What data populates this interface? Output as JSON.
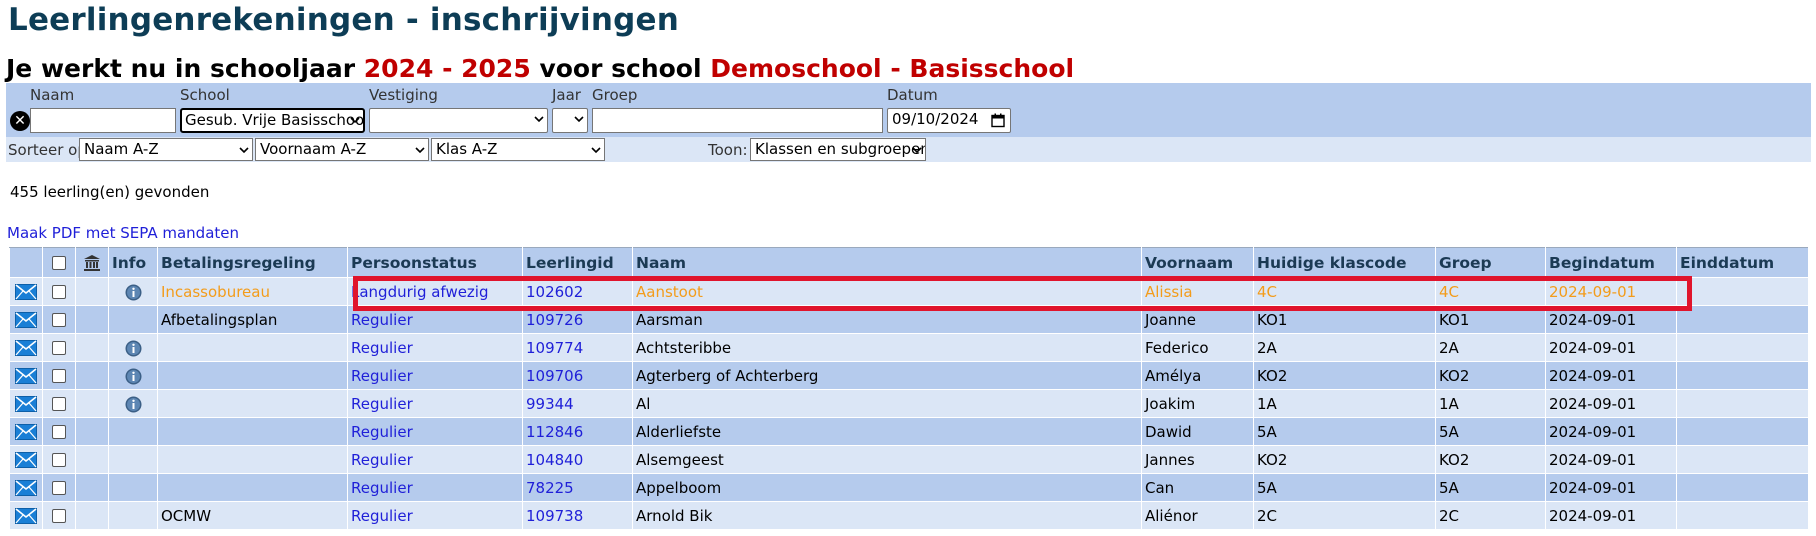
{
  "page": {
    "title": "Leerlingenrekeningen - inschrijvingen",
    "year_prefix": "Je werkt nu in schooljaar",
    "year": "2024 - 2025",
    "school_prefix": "voor school",
    "school": "Demoschool - Basisschool"
  },
  "filters": {
    "name_label": "Naam",
    "name_value": "",
    "school_label": "School",
    "school_value": "Gesub. Vrije Basisschool",
    "vestiging_label": "Vestiging",
    "vestiging_value": "",
    "jaar_label": "Jaar",
    "jaar_value": "",
    "groep_label": "Groep",
    "groep_value": "",
    "datum_label": "Datum",
    "datum_value": "09/10/2024",
    "clear_icon": "close-circle-icon"
  },
  "sort": {
    "label": "Sorteer op:",
    "sort1": "Naam A-Z",
    "sort2": "Voornaam A-Z",
    "sort3": "Klas A-Z",
    "show_label": "Toon:",
    "show_value": "Klassen en subgroepen"
  },
  "result_count": "455 leerling(en) gevonden",
  "pdf_link": "Maak PDF met SEPA mandaten",
  "table": {
    "headers": {
      "info": "Info",
      "betalingsregeling": "Betalingsregeling",
      "persoonstatus": "Persoonstatus",
      "leerlingid": "Leerlingid",
      "naam": "Naam",
      "voornaam": "Voornaam",
      "klascode": "Huidige klascode",
      "groep": "Groep",
      "begindatum": "Begindatum",
      "einddatum": "Einddatum"
    },
    "rows": [
      {
        "info": true,
        "betalingsregeling": "Incassobureau",
        "persoonstatus": "Langdurig afwezig",
        "leerlingid": "102602",
        "naam": "Aanstoot",
        "voornaam": "Alissia",
        "klascode": "4C",
        "groep": "4C",
        "begindatum": "2024-09-01",
        "einddatum": "",
        "highlight": true
      },
      {
        "info": false,
        "betalingsregeling": "Afbetalingsplan",
        "persoonstatus": "Regulier",
        "leerlingid": "109726",
        "naam": "Aarsman",
        "voornaam": "Joanne",
        "klascode": "KO1",
        "groep": "KO1",
        "begindatum": "2024-09-01",
        "einddatum": ""
      },
      {
        "info": true,
        "betalingsregeling": "",
        "persoonstatus": "Regulier",
        "leerlingid": "109774",
        "naam": "Achtsteribbe",
        "voornaam": "Federico",
        "klascode": "2A",
        "groep": "2A",
        "begindatum": "2024-09-01",
        "einddatum": ""
      },
      {
        "info": true,
        "betalingsregeling": "",
        "persoonstatus": "Regulier",
        "leerlingid": "109706",
        "naam": "Agterberg of Achterberg",
        "voornaam": "Amélya",
        "klascode": "KO2",
        "groep": "KO2",
        "begindatum": "2024-09-01",
        "einddatum": ""
      },
      {
        "info": true,
        "betalingsregeling": "",
        "persoonstatus": "Regulier",
        "leerlingid": "99344",
        "naam": "Al",
        "voornaam": "Joakim",
        "klascode": "1A",
        "groep": "1A",
        "begindatum": "2024-09-01",
        "einddatum": ""
      },
      {
        "info": false,
        "betalingsregeling": "",
        "persoonstatus": "Regulier",
        "leerlingid": "112846",
        "naam": "Alderliefste",
        "voornaam": "Dawid",
        "klascode": "5A",
        "groep": "5A",
        "begindatum": "2024-09-01",
        "einddatum": ""
      },
      {
        "info": false,
        "betalingsregeling": "",
        "persoonstatus": "Regulier",
        "leerlingid": "104840",
        "naam": "Alsemgeest",
        "voornaam": "Jannes",
        "klascode": "KO2",
        "groep": "KO2",
        "begindatum": "2024-09-01",
        "einddatum": ""
      },
      {
        "info": false,
        "betalingsregeling": "",
        "persoonstatus": "Regulier",
        "leerlingid": "78225",
        "naam": "Appelboom",
        "voornaam": "Can",
        "klascode": "5A",
        "groep": "5A",
        "begindatum": "2024-09-01",
        "einddatum": ""
      },
      {
        "info": false,
        "betalingsregeling": "OCMW",
        "persoonstatus": "Regulier",
        "leerlingid": "109738",
        "naam": "Arnold Bik",
        "voornaam": "Aliénor",
        "klascode": "2C",
        "groep": "2C",
        "begindatum": "2024-09-01",
        "einddatum": ""
      }
    ]
  },
  "icons": {
    "mail": "envelope-icon",
    "info": "info-icon",
    "bank": "bank-icon"
  },
  "colors": {
    "title": "#0d3d56",
    "highlight_red": "#c00000",
    "link_blue": "#1f1fd8",
    "orange": "#f39c1b",
    "header_bg": "#b5cbed",
    "row_light": "#dbe6f6",
    "annotation_box": "#e0142c"
  }
}
